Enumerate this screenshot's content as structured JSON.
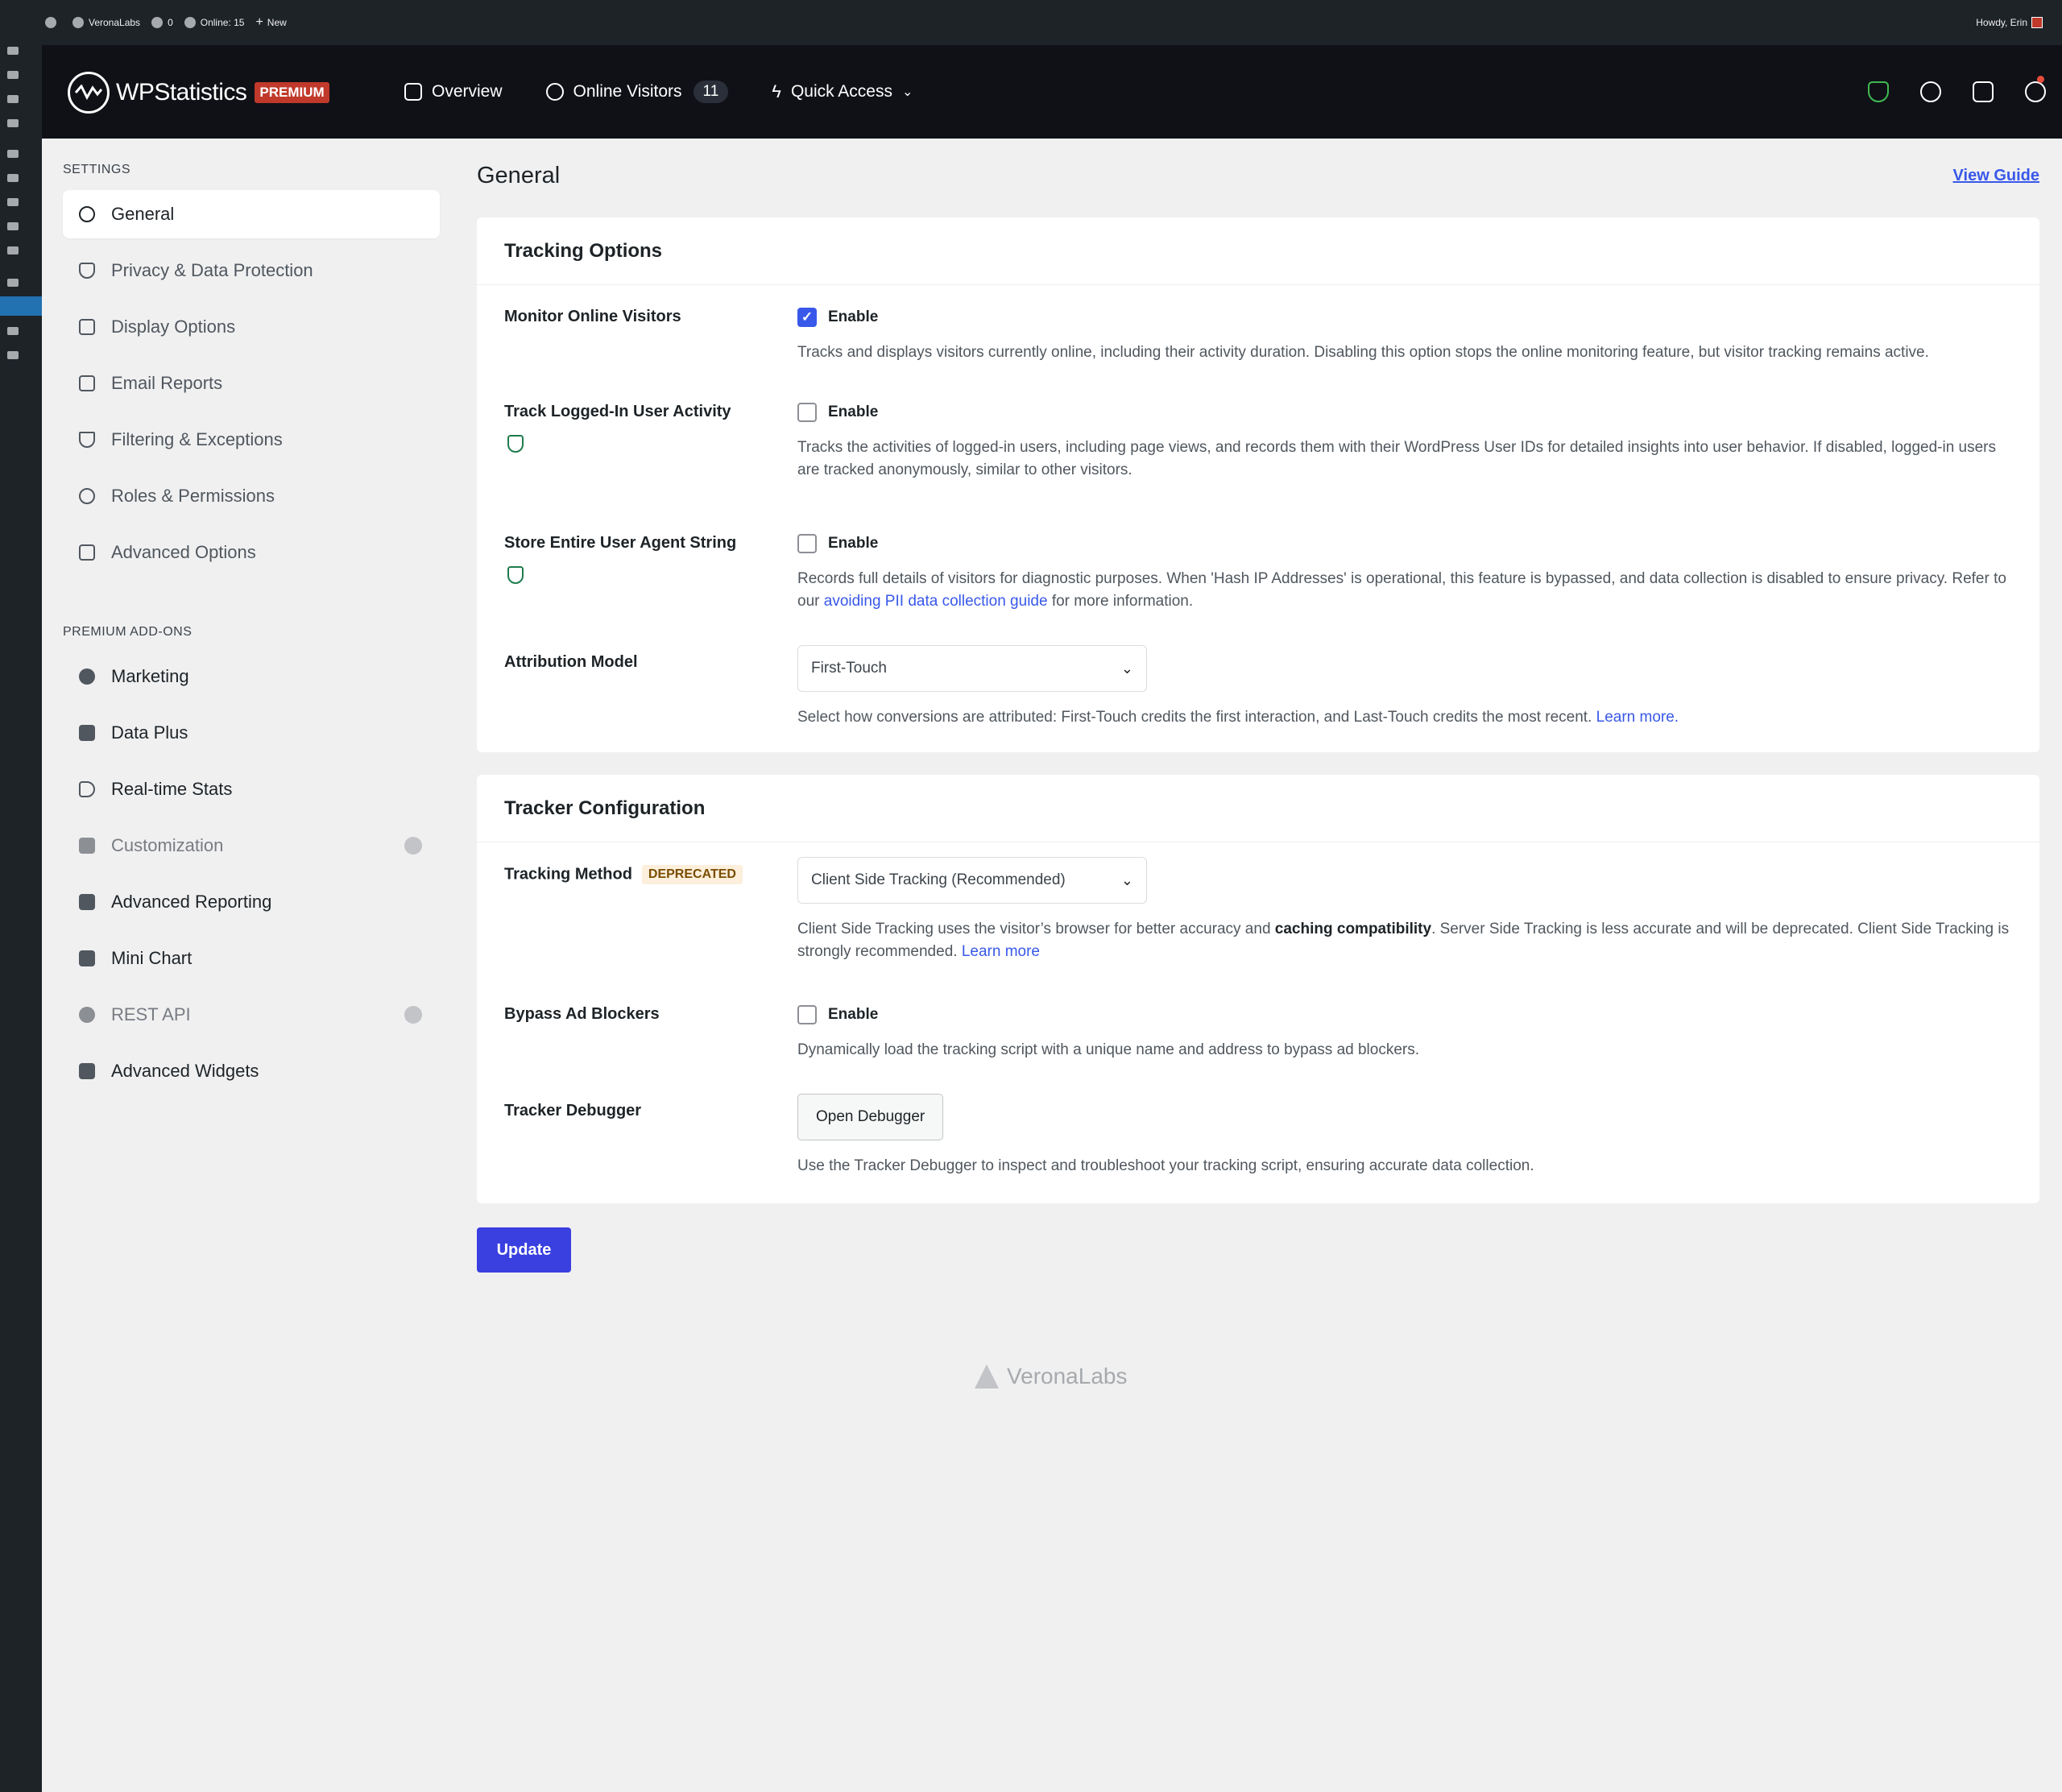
{
  "admin_bar": {
    "site_name": "VeronaLabs",
    "comments_count": "0",
    "online": "Online: 15",
    "new_label": "New",
    "greeting": "Howdy, Erin"
  },
  "header": {
    "brand": "WPStatistics",
    "premium_label": "PREMIUM",
    "nav": {
      "overview": "Overview",
      "online_visitors": "Online Visitors",
      "online_visitors_count": "11",
      "quick_access": "Quick Access"
    }
  },
  "sidebar": {
    "settings_heading": "SETTINGS",
    "items": [
      {
        "label": "General",
        "icon": "gear-icon"
      },
      {
        "label": "Privacy & Data Protection",
        "icon": "shield-icon"
      },
      {
        "label": "Display Options",
        "icon": "grid-icon"
      },
      {
        "label": "Email Reports",
        "icon": "envelope-icon"
      },
      {
        "label": "Filtering & Exceptions",
        "icon": "filter-icon"
      },
      {
        "label": "Roles & Permissions",
        "icon": "user-key-icon"
      },
      {
        "label": "Advanced Options",
        "icon": "sliders-icon"
      }
    ],
    "addons_heading": "PREMIUM ADD-ONS",
    "addons": [
      {
        "label": "Marketing",
        "icon": "marketing-icon"
      },
      {
        "label": "Data Plus",
        "icon": "bar-chart-icon"
      },
      {
        "label": "Real-time Stats",
        "icon": "realtime-icon"
      },
      {
        "label": "Customization",
        "icon": "paint-bucket-icon"
      },
      {
        "label": "Advanced Reporting",
        "icon": "report-icon"
      },
      {
        "label": "Mini Chart",
        "icon": "mini-chart-icon"
      },
      {
        "label": "REST API",
        "icon": "api-icon"
      },
      {
        "label": "Advanced Widgets",
        "icon": "widgets-icon"
      }
    ]
  },
  "main": {
    "title": "General",
    "view_guide": "View Guide",
    "tracking_options": {
      "title": "Tracking Options",
      "monitor_online": {
        "label": "Monitor Online Visitors",
        "enable": "Enable",
        "checked": true,
        "desc": "Tracks and displays visitors currently online, including their activity duration. Disabling this option stops the online monitoring feature, but visitor tracking remains active."
      },
      "track_logged_in": {
        "label": "Track Logged-In User Activity",
        "enable": "Enable",
        "checked": false,
        "desc": "Tracks the activities of logged-in users, including page views, and records them with their WordPress User IDs for detailed insights into user behavior. If disabled, logged-in users are tracked anonymously, similar to other visitors."
      },
      "store_user_agent": {
        "label": "Store Entire User Agent String",
        "enable": "Enable",
        "checked": false,
        "desc_pre": "Records full details of visitors for diagnostic purposes. When 'Hash IP Addresses' is operational, this feature is bypassed, and data collection is disabled to ensure privacy. Refer to our ",
        "desc_link": "avoiding PII data collection guide",
        "desc_post": " for more information."
      },
      "attribution": {
        "label": "Attribution Model",
        "selected": "First-Touch",
        "desc_pre": "Select how conversions are attributed: First-Touch credits the first interaction, and Last-Touch credits the most recent. ",
        "desc_link": "Learn more."
      }
    },
    "tracker_config": {
      "title": "Tracker Configuration",
      "tracking_method": {
        "label": "Tracking Method",
        "badge": "DEPRECATED",
        "selected": "Client Side Tracking (Recommended)",
        "desc_pre": "Client Side Tracking uses the visitor’s browser for better accuracy and ",
        "desc_bold": "caching compatibility",
        "desc_post": ". Server Side Tracking is less accurate and will be deprecated. Client Side Tracking is strongly recommended. ",
        "desc_link": "Learn more"
      },
      "bypass_ad_blockers": {
        "label": "Bypass Ad Blockers",
        "enable": "Enable",
        "checked": false,
        "desc": "Dynamically load the tracking script with a unique name and address to bypass ad blockers."
      },
      "tracker_debugger": {
        "label": "Tracker Debugger",
        "button": "Open Debugger",
        "desc": "Use the Tracker Debugger to inspect and troubleshoot your tracking script, ensuring accurate data collection."
      }
    },
    "update_button": "Update"
  },
  "footer": {
    "logo_text": "VeronaLabs"
  }
}
